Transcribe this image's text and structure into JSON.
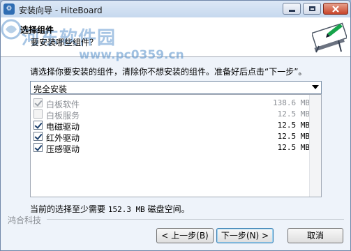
{
  "window": {
    "title": "安装向导 - HiteBoard",
    "icon": "installer-icon"
  },
  "header": {
    "title": "选择组件",
    "subtitle": "要安装哪些组件？",
    "watermark": "河东软件园",
    "watermark_url": "www.pc0359.cn"
  },
  "body": {
    "instruction": "请选择你要安装的组件，清除你不想安装的组件。准备好后点击“下一步”。",
    "install_type": "完全安装",
    "components": [
      {
        "label": "白板软件",
        "size": "138.6 MB",
        "checked": true,
        "disabled": true
      },
      {
        "label": "白板服务",
        "size": "12.5 MB",
        "checked": false,
        "disabled": true
      },
      {
        "label": "电磁驱动",
        "size": "12.5 MB",
        "checked": true,
        "disabled": false
      },
      {
        "label": "红外驱动",
        "size": "12.5 MB",
        "checked": true,
        "disabled": false
      },
      {
        "label": "压感驱动",
        "size": "12.5 MB",
        "checked": true,
        "disabled": false
      }
    ],
    "space_prefix": "当前的选择至少需要 ",
    "space_value": "152.3 MB",
    "space_suffix": " 磁盘空间。"
  },
  "footer": {
    "brand": "鸿合科技",
    "back_label": "< 上一步(B)",
    "next_label": "下一步(N) >",
    "cancel_label": "取消"
  },
  "colors": {
    "accent": "#3c7fb1",
    "watermark": "#5f96cd"
  }
}
